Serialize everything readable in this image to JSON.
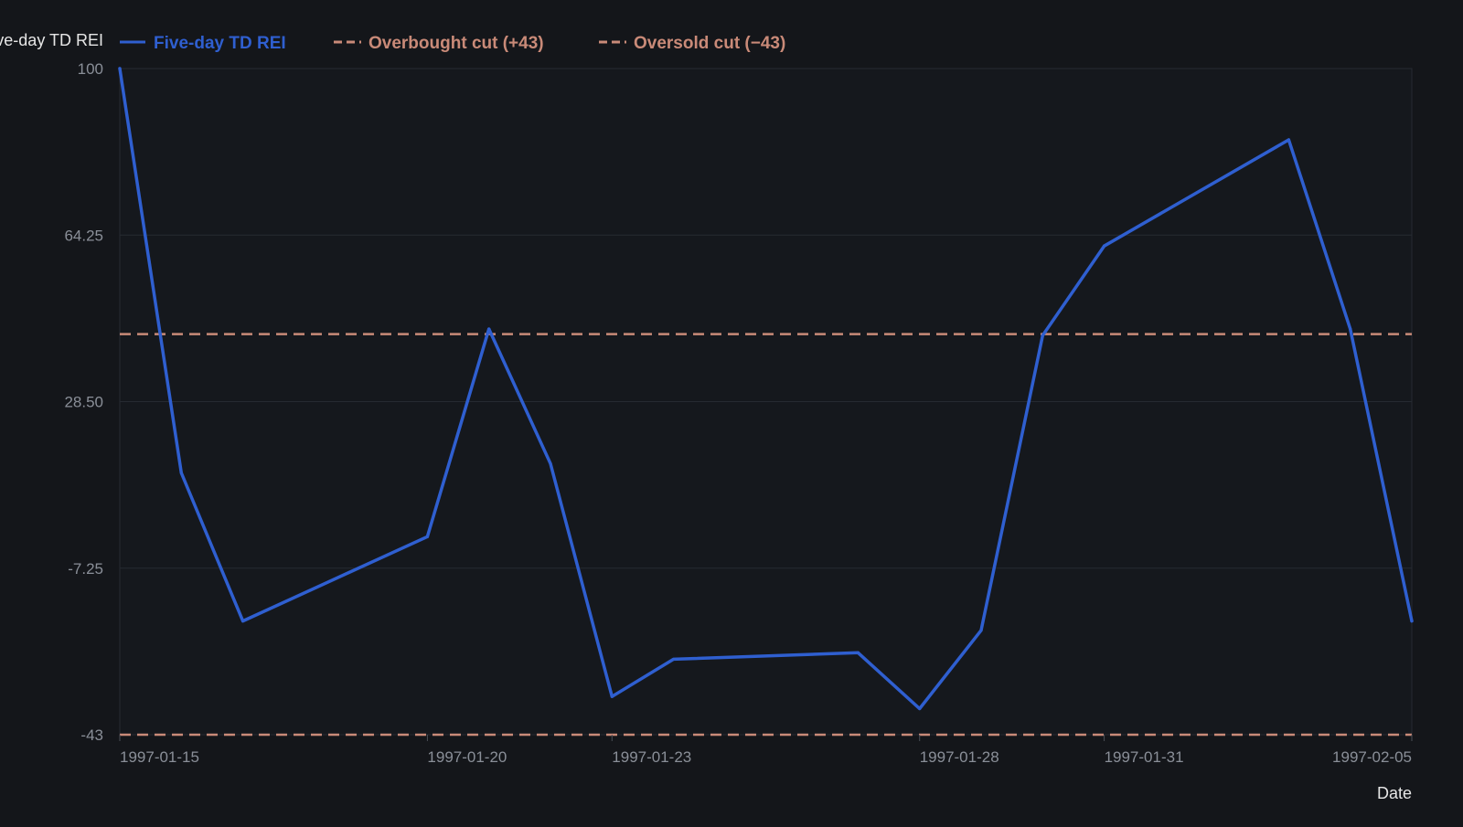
{
  "colors": {
    "background": "#14161a",
    "plot_background": "#15181d",
    "grid": "#262a31",
    "series": "#2f5fd0",
    "threshold": "#c98a78",
    "tick_text": "#8a8f98",
    "axis_title": "#e6e6e6"
  },
  "chart_data": {
    "type": "line",
    "title": "",
    "xlabel": "Date",
    "ylabel": "Five-day TD REI",
    "ylim": [
      -43,
      100
    ],
    "yticks": [
      100,
      64.25,
      28.5,
      -7.25,
      -43
    ],
    "ytick_labels": [
      "100",
      "64.25",
      "28.50",
      "-7.25",
      "-43"
    ],
    "xlim": [
      "1997-01-15",
      "1997-02-05"
    ],
    "xticks": [
      "1997-01-15",
      "1997-01-20",
      "1997-01-23",
      "1997-01-28",
      "1997-01-31",
      "1997-02-05"
    ],
    "grid": true,
    "legend_position": "top-left",
    "series": [
      {
        "name": "Five-day TD REI",
        "style": "solid",
        "x": [
          "1997-01-15",
          "1997-01-16",
          "1997-01-17",
          "1997-01-20",
          "1997-01-21",
          "1997-01-22",
          "1997-01-23",
          "1997-01-24",
          "1997-01-27",
          "1997-01-28",
          "1997-01-29",
          "1997-01-30",
          "1997-01-31",
          "1997-02-03",
          "1997-02-04",
          "1997-02-05"
        ],
        "y": [
          100,
          13.2,
          -18.6,
          -0.5,
          44.1,
          15.2,
          -34.8,
          -26.8,
          -25.4,
          -37.4,
          -20.6,
          42.7,
          61.9,
          84.7,
          44.1,
          -18.6
        ]
      },
      {
        "name": "Overbought cut (+43)",
        "style": "dashed",
        "value": 43
      },
      {
        "name": "Oversold cut (−43)",
        "style": "dashed",
        "value": -43
      }
    ]
  }
}
